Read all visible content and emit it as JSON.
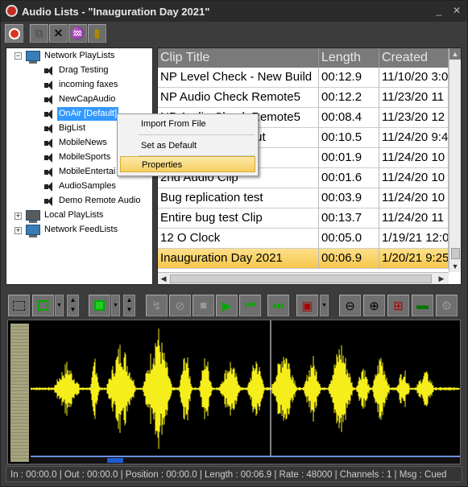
{
  "window": {
    "title": "Audio Lists - \"Inauguration Day 2021\""
  },
  "tree": {
    "root": "Network PlayLists",
    "items": [
      "Drag Testing",
      "incoming faxes",
      "NewCapAudio",
      "OnAir [Default]",
      "BigList",
      "MobileNews",
      "MobileSports",
      "MobileEntertai",
      "AudioSamples",
      "Demo Remote Audio"
    ],
    "local": "Local PlayLists",
    "feeds": "Network FeedLists"
  },
  "grid": {
    "columns": [
      "Clip Title",
      "Length",
      "Created"
    ],
    "rows": [
      [
        "NP Level Check - New Build",
        "00:12.9",
        "11/10/20 3:0"
      ],
      [
        "NP Audio Check Remote5",
        "00:12.2",
        "11/23/20 11"
      ],
      [
        "NP Audio Check Remote5",
        "00:08.4",
        "11/23/20 12"
      ],
      [
        "NP Updated Layout",
        "00:10.5",
        "11/24/20 9:4"
      ],
      [
        "2nd Audio Clip",
        "00:01.9",
        "11/24/20 10"
      ],
      [
        "2nd Audio Clip",
        "00:01.6",
        "11/24/20 10"
      ],
      [
        "Bug replication test",
        "00:03.9",
        "11/24/20 10"
      ],
      [
        "Entire bug test Clip",
        "00:13.7",
        "11/24/20 11"
      ],
      [
        "12 O Clock",
        "00:05.0",
        "1/19/21 12:0"
      ],
      [
        "Inauguration Day 2021",
        "00:06.9",
        "1/20/21 9:25"
      ]
    ]
  },
  "context_menu": {
    "items": [
      "Import From File",
      "Set as Default",
      "Properties"
    ]
  },
  "status": {
    "text": "In : 00:00.0 | Out : 00:00.0 | Position : 00:00.0 | Length : 00:06.9 | Rate : 48000 | Channels : 1 | Msg : Cued"
  },
  "colors": {
    "wave": "#f5ee1a",
    "selection": "#f4c64a",
    "tree_selection": "#3399ff"
  }
}
